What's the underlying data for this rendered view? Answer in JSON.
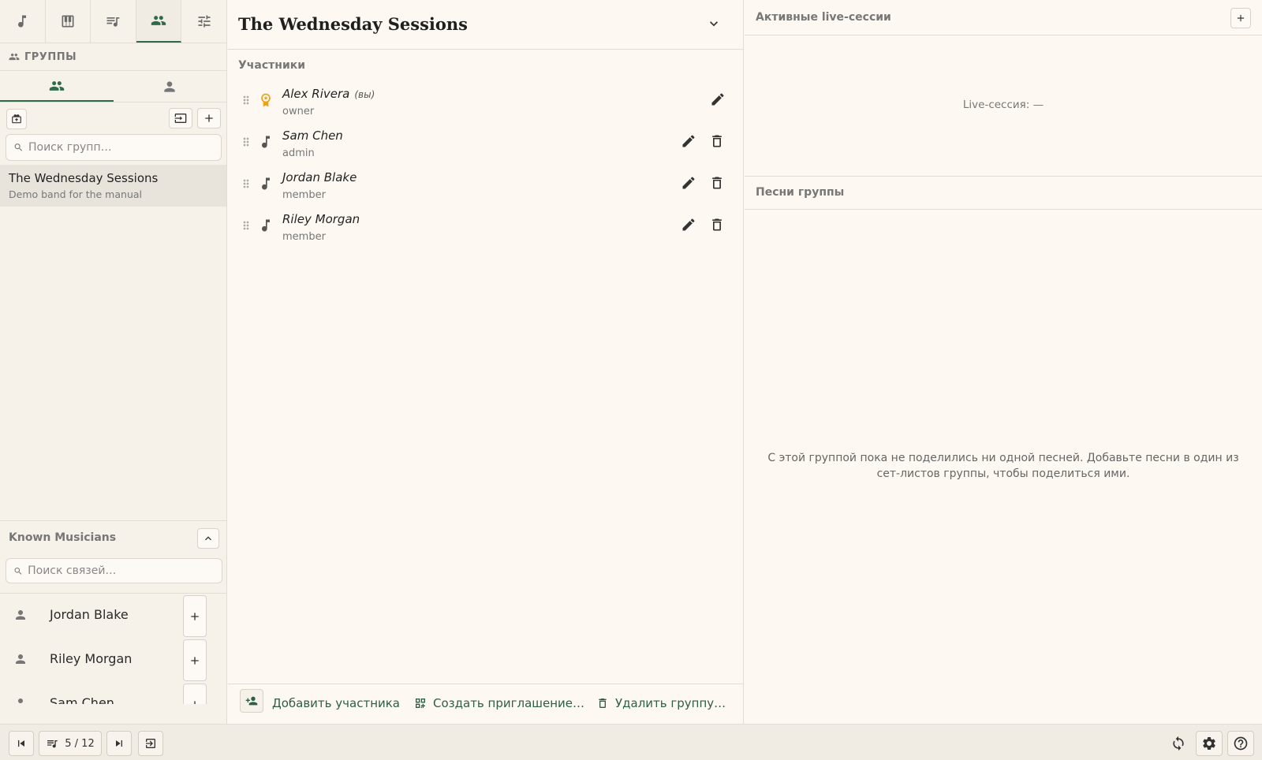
{
  "colors": {
    "accent": "#2f6b4a",
    "owner_badge": "#e8a317",
    "background": "#fdf8f2"
  },
  "sidebar": {
    "top_tabs": [
      {
        "icon": "music-note-icon"
      },
      {
        "icon": "piano-icon"
      },
      {
        "icon": "playlist-icon"
      },
      {
        "icon": "groups-icon",
        "active": true
      },
      {
        "icon": "tune-icon"
      }
    ],
    "section_title": "ГРУППЫ",
    "group_search_placeholder": "Поиск групп…",
    "groups": [
      {
        "name": "The Wednesday Sessions",
        "description": "Demo band for the manual"
      }
    ],
    "known_musicians": {
      "title": "Known Musicians",
      "search_placeholder": "Поиск связей…",
      "items": [
        {
          "name": "Jordan Blake"
        },
        {
          "name": "Riley Morgan"
        },
        {
          "name": "Sam Chen"
        }
      ]
    }
  },
  "group": {
    "title": "The Wednesday Sessions",
    "members_label": "Участники",
    "members": [
      {
        "name": "Alex Rivera",
        "you_label": "(вы)",
        "role": "owner"
      },
      {
        "name": "Sam Chen",
        "role": "admin"
      },
      {
        "name": "Jordan Blake",
        "role": "member"
      },
      {
        "name": "Riley Morgan",
        "role": "member"
      }
    ],
    "footer": {
      "add_member": "Добавить участника",
      "create_invite": "Создать приглашение…",
      "delete_group": "Удалить группу…"
    }
  },
  "right": {
    "live_sessions_title": "Активные live-сессии",
    "live_session_status": "Live-сессия: —",
    "songs_title": "Песни группы",
    "songs_empty": "С этой группой пока не поделились ни одной песней. Добавьте песни в один из сет-листов группы, чтобы поделиться ими."
  },
  "bottombar": {
    "setlist_position": "5 / 12"
  }
}
